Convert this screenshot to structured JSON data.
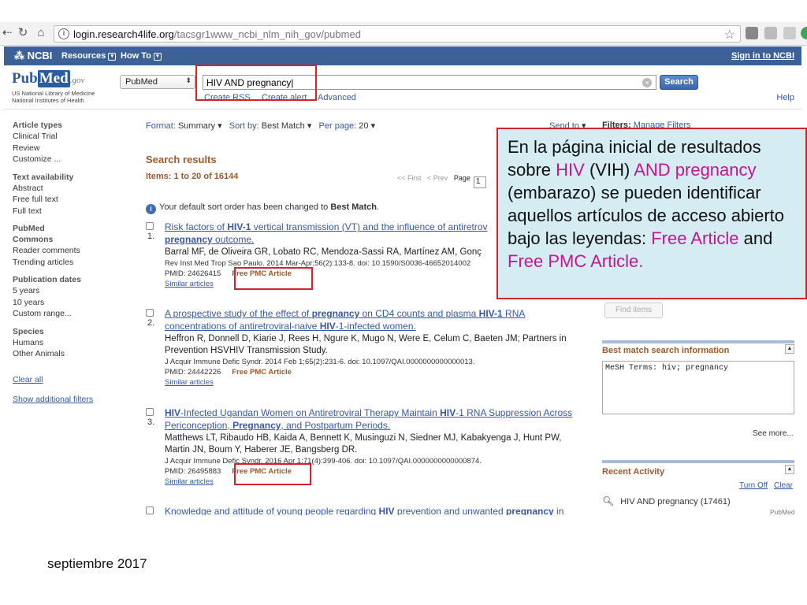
{
  "browser": {
    "url_host": "login.research4life.org",
    "url_path": "/tacsgr1www_ncbi_nlm_nih_gov/pubmed"
  },
  "ncbi_bar": {
    "logo": "NCBI",
    "resources": "Resources",
    "howto": "How To",
    "signin": "Sign in to NCBI"
  },
  "header": {
    "logo_pub": "Pub",
    "logo_med": "Med",
    "logo_gov": ".gov",
    "lib1": "US National Library of Medicine",
    "lib2": "National Institutes of Health",
    "db_value": "PubMed",
    "search_value": "HIV AND pregnancy",
    "search_button": "Search",
    "create_rss": "Create RSS",
    "create_alert": "Create alert",
    "advanced": "Advanced",
    "help": "Help"
  },
  "sidebar": {
    "article_types": "Article types",
    "at_items": [
      "Clinical Trial",
      "Review",
      "Customize ..."
    ],
    "text_availability": "Text availability",
    "ta_items": [
      "Abstract",
      "Free full text",
      "Full text"
    ],
    "pubmed_commons_1": "PubMed",
    "pubmed_commons_2": "Commons",
    "pc_items": [
      "Reader comments",
      "Trending articles"
    ],
    "publication_dates": "Publication dates",
    "pd_items": [
      "5 years",
      "10 years",
      "Custom range..."
    ],
    "species": "Species",
    "sp_items": [
      "Humans",
      "Other Animals"
    ],
    "clear_all": "Clear all",
    "show_filters": "Show additional filters"
  },
  "toolbar": {
    "format_label": "Format:",
    "format_value": "Summary",
    "sort_label": "Sort by:",
    "sort_value": "Best Match",
    "perpage_label": "Per page:",
    "perpage_value": "20",
    "send_to": "Send to",
    "filters": "Filters:",
    "manage_filters": "Manage Filters"
  },
  "results": {
    "heading": "Search results",
    "items": "Items: 1 to 20 of 16144",
    "first": "<< First",
    "prev": "< Prev",
    "page_label": "Page",
    "page_value": "1",
    "notice_pre": "Your default sort order has been changed to ",
    "notice_bold": "Best Match",
    "notice_post": ".",
    "free_pmc": "Free PMC Article",
    "similar": "Similar articles",
    "list": [
      {
        "num": "1.",
        "title_html": "Risk factors of <b>HIV-1</b> vertical transmission (VT) and the influence of antiretrov",
        "title2_html": "<b>pregnancy</b> outcome.",
        "authors": "Barral MF, de Oliveira GR, Lobato RC, Mendoza-Sassi RA, Martínez AM, Gonç",
        "source": "Rev Inst Med Trop Sao Paulo. 2014 Mar-Apr;56(2):133-8. doi: 10.1590/S0036-46652014002",
        "pmid": "PMID: 24626415"
      },
      {
        "num": "2.",
        "title_html": "A prospective study of the effect of <b>pregnancy</b> on CD4 counts and plasma <b>HIV-1</b> RNA",
        "title2_html": "concentrations of antiretroviral-naive <b>HIV</b>-1-infected women.",
        "authors": "Heffron R, Donnell D, Kiarie J, Rees H, Ngure K, Mugo N, Were E, Celum C, Baeten JM; Partners in",
        "authors2": "Prevention HSVHIV Transmission Study.",
        "source": "J Acquir Immune Defic Syndr. 2014 Feb 1;65(2):231-6. doi: 10.1097/QAI.0000000000000013.",
        "pmid": "PMID: 24442226"
      },
      {
        "num": "3.",
        "title_html": "<b>HIV</b>-Infected Ugandan Women on Antiretroviral Therapy Maintain <b>HIV</b>-1 RNA Suppression Across",
        "title2_html": "Periconception, <b>Pregnancy</b>, and Postpartum Periods.",
        "authors": "Matthews LT, Ribaudo HB, Kaida A, Bennett K, Musinguzi N, Siedner MJ, Kabakyenga J, Hunt PW,",
        "authors2": "Martin JN, Boum Y, Haberer JE, Bangsberg DR.",
        "source": "J Acquir Immune Defic Syndr. 2016 Apr 1;71(4):399-406. doi: 10.1097/QAI.0000000000000874.",
        "pmid": "PMID: 26495883"
      },
      {
        "title_html": "Knowledge and attitude of young people regarding <b>HIV</b> prevention and unwanted <b>pregnancy</b> in"
      }
    ]
  },
  "right": {
    "find_items": "Find items",
    "best_match_title": "Best match search information",
    "mesh_text": "MeSH Terms: hiv; pregnancy",
    "see_more": "See more...",
    "recent_title": "Recent Activity",
    "turn_off": "Turn Off",
    "clear": "Clear",
    "recent_item": "HIV AND pregnancy (17461)",
    "recent_db": "PubMed"
  },
  "callout": {
    "p1": "En la página inicial de resultados sobre ",
    "hiv": "HIV",
    "p2": " (VIH) ",
    "and": "AND",
    "p3": " ",
    "preg": "pregnancy",
    "p4": " (embarazo) se pueden identificar aquellos artículos de acceso abierto bajo las leyendas: ",
    "fa": "Free Article",
    "p5": " and ",
    "fpa": "Free PMC Article."
  },
  "footer": {
    "date": "septiembre 2017"
  }
}
